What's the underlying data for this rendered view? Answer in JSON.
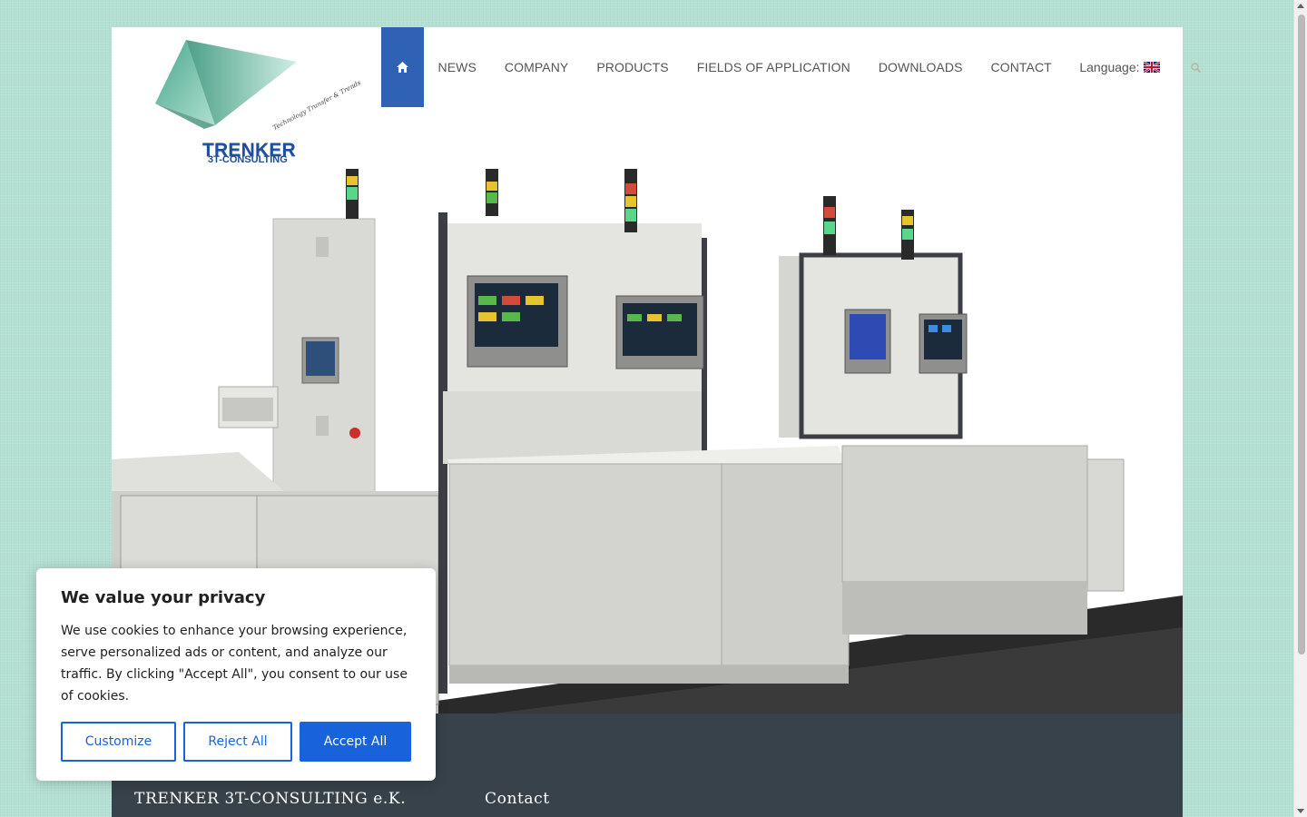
{
  "brand": {
    "name": "TRENKER",
    "subname": "3T-CONSULTING",
    "tagline": "Technology Transfer & Trends"
  },
  "nav": {
    "items": [
      {
        "label": "NEWS"
      },
      {
        "label": "COMPANY"
      },
      {
        "label": "PRODUCTS"
      },
      {
        "label": "FIELDS OF APPLICATION"
      },
      {
        "label": "DOWNLOADS"
      },
      {
        "label": "CONTACT"
      }
    ],
    "language_label": "Language:",
    "home_icon": "home-icon",
    "search_icon": "search-icon",
    "accent": "#2f62b5"
  },
  "footer": {
    "company": "TRENKER 3T-CONSULTING e.K.",
    "contact_heading": "Contact",
    "background": "#37424a"
  },
  "cookie": {
    "title": "We value your privacy",
    "body": "We use cookies to enhance your browsing experience, serve personalized ads or content, and analyze our traffic. By clicking \"Accept All\", you consent to our use of cookies.",
    "customize_label": "Customize",
    "reject_label": "Reject All",
    "accept_label": "Accept All",
    "accent": "#1863dc"
  }
}
